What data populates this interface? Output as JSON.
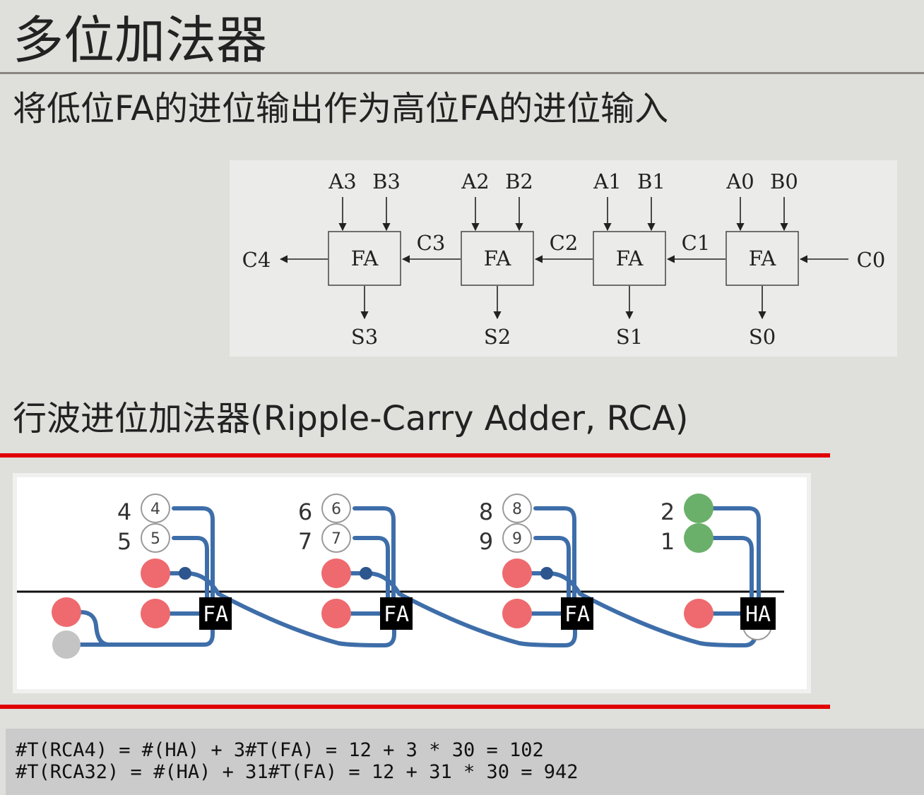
{
  "slide": {
    "title": "多位加法器",
    "subtitle": "将低位FA的进位输出作为高位FA的进位输入",
    "section_heading": "行波进位加法器(Ripple-Carry Adder, RCA)"
  },
  "diagram": {
    "stages": [
      {
        "a": "A3",
        "b": "B3",
        "block": "FA",
        "sum": "S3"
      },
      {
        "a": "A2",
        "b": "B2",
        "block": "FA",
        "sum": "S2"
      },
      {
        "a": "A1",
        "b": "B1",
        "block": "FA",
        "sum": "S1"
      },
      {
        "a": "A0",
        "b": "B0",
        "block": "FA",
        "sum": "S0"
      }
    ],
    "carries": [
      "C4",
      "C3",
      "C2",
      "C1",
      "C0"
    ]
  },
  "circuit": {
    "units": [
      {
        "label": "FA",
        "top_digit": "4",
        "bottom_digit": "5"
      },
      {
        "label": "FA",
        "top_digit": "6",
        "bottom_digit": "7"
      },
      {
        "label": "FA",
        "top_digit": "8",
        "bottom_digit": "9"
      },
      {
        "label": "HA",
        "top_digit": "2",
        "bottom_digit": "1"
      }
    ],
    "colors": {
      "wire": "#3e6ea9",
      "red_node": "#ee6a6e",
      "green_node": "#6ab06a",
      "grey_node": "#c4c4c4",
      "gate": "#000000"
    }
  },
  "code": {
    "lines": [
      "#T(RCA4) = #(HA) + 3#T(FA) = 12 + 3 * 30 = 102",
      "#T(RCA32) = #(HA) + 31#T(FA) = 12 + 31 * 30 = 942"
    ]
  }
}
